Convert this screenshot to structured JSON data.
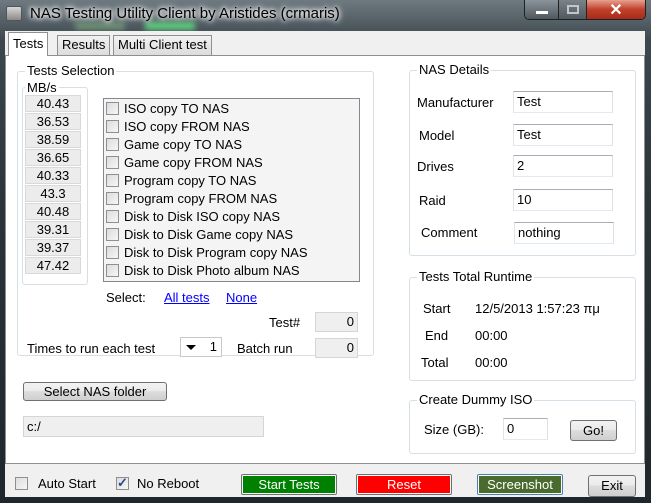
{
  "window": {
    "title": "NAS Testing Utility Client by Aristides (crmaris)"
  },
  "tabs": [
    {
      "label": "Tests",
      "active": true
    },
    {
      "label": "Results",
      "active": false
    },
    {
      "label": "Multi Client test",
      "active": false
    }
  ],
  "tests_selection": {
    "title": "Tests Selection",
    "mbs_title": "MB/s",
    "tests": [
      {
        "label": "ISO copy TO NAS",
        "mbs": "40.43",
        "checked": false
      },
      {
        "label": "ISO copy FROM NAS",
        "mbs": "36.53",
        "checked": false
      },
      {
        "label": "Game copy TO NAS",
        "mbs": "38.59",
        "checked": false
      },
      {
        "label": "Game copy FROM NAS",
        "mbs": "36.65",
        "checked": false
      },
      {
        "label": "Program copy TO NAS",
        "mbs": "40.33",
        "checked": false
      },
      {
        "label": "Program copy FROM NAS",
        "mbs": "43.3",
        "checked": false
      },
      {
        "label": "Disk to Disk ISO copy NAS",
        "mbs": "40.48",
        "checked": false
      },
      {
        "label": "Disk to Disk Game copy NAS",
        "mbs": "39.31",
        "checked": false
      },
      {
        "label": "Disk to Disk Program copy NAS",
        "mbs": "39.37",
        "checked": false
      },
      {
        "label": "Disk to Disk Photo album NAS",
        "mbs": "47.42",
        "checked": false
      }
    ],
    "select_label": "Select:",
    "all_tests_link": "All tests",
    "none_link": "None",
    "test_num_label": "Test#",
    "test_num_value": "0",
    "times_label": "Times to run each test",
    "times_value": "1",
    "batch_label": "Batch run",
    "batch_value": "0"
  },
  "folder": {
    "button_label": "Select NAS folder",
    "path": "c:/"
  },
  "nas_details": {
    "title": "NAS Details",
    "fields": [
      {
        "label": "Manufacturer",
        "value": "Test"
      },
      {
        "label": "Model",
        "value": "Test"
      },
      {
        "label": "Drives",
        "value": "2"
      },
      {
        "label": "Raid",
        "value": "10"
      },
      {
        "label": "Comment",
        "value": "nothing"
      }
    ]
  },
  "runtime": {
    "title": "Tests Total Runtime",
    "start_label": "Start",
    "start_value": "12/5/2013 1:57:23 πμ",
    "end_label": "End",
    "end_value": "00:00",
    "total_label": "Total",
    "total_value": "00:00"
  },
  "dummy_iso": {
    "title": "Create Dummy ISO",
    "size_label": "Size (GB):",
    "size_value": "0",
    "go_label": "Go!"
  },
  "bottom": {
    "auto_start_label": "Auto Start",
    "auto_start_checked": false,
    "no_reboot_label": "No Reboot",
    "no_reboot_checked": true,
    "start_tests_label": "Start Tests",
    "reset_label": "Reset",
    "screenshot_label": "Screenshot",
    "exit_label": "Exit"
  },
  "colors": {
    "start_tests": "#008000",
    "reset": "#ff0000",
    "screenshot": "#4a6b2e",
    "link": "#0000ff"
  }
}
